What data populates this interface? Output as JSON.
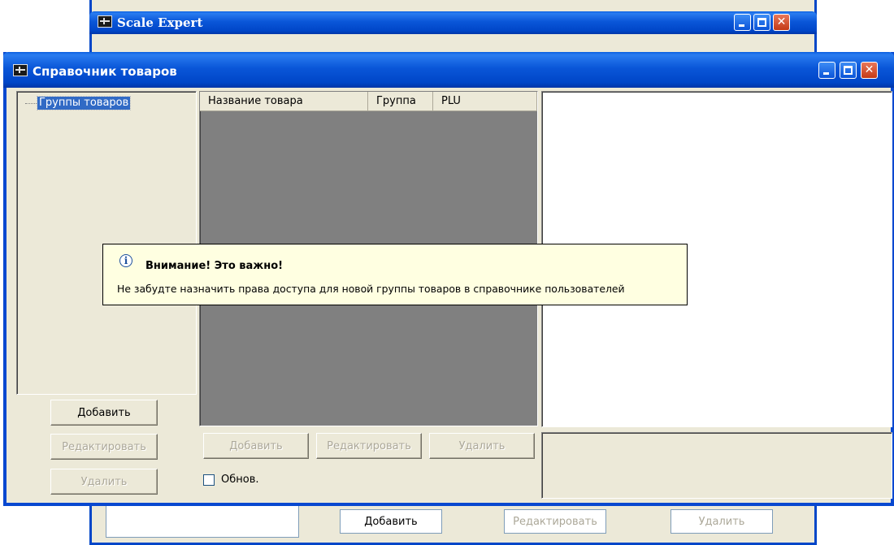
{
  "background_window": {
    "title": "Scale Expert",
    "buttons": {
      "add": "Добавить",
      "edit": "Редактировать",
      "delete": "Удалить"
    }
  },
  "dialog": {
    "title": "Справочник товаров",
    "tree": {
      "root_label": "Группы товаров"
    },
    "left_buttons": {
      "add": "Добавить",
      "edit": "Редактировать",
      "delete": "Удалить"
    },
    "table": {
      "columns": [
        "Название товара",
        "Группа",
        "PLU"
      ],
      "rows": []
    },
    "middle_buttons": {
      "add": "Добавить",
      "edit": "Редактировать",
      "delete": "Удалить"
    },
    "refresh_checkbox": {
      "label": "Обнов.",
      "checked": false
    }
  },
  "tooltip": {
    "title": "Внимание! Это важно!",
    "message": "Не забудте назначить права доступа для новой группы товаров в справочнике пользователей",
    "icon": "info-icon"
  },
  "colors": {
    "title_bar": "#0054e3",
    "window_face": "#ece9d8",
    "table_background": "#808080",
    "tooltip_background": "#ffffe1",
    "selection": "#316ac5"
  }
}
